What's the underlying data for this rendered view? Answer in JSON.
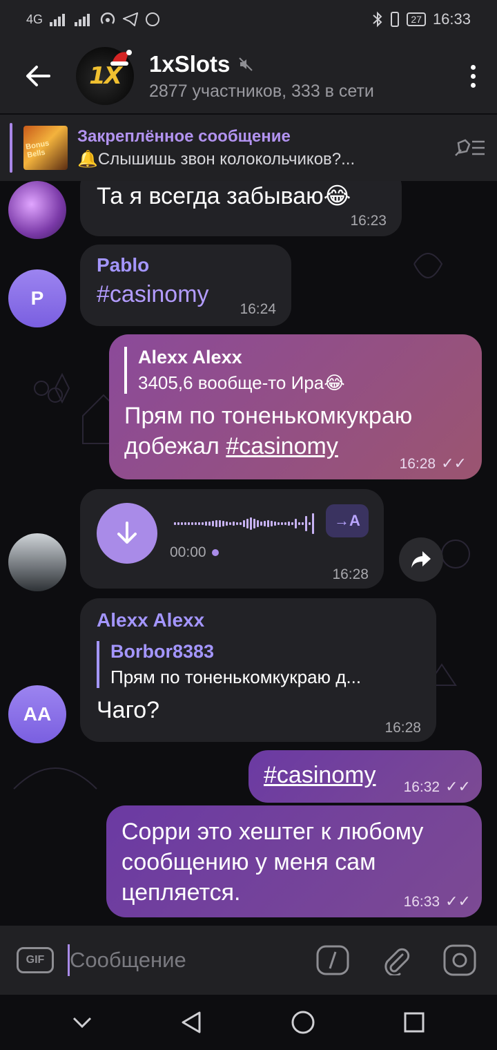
{
  "status_bar": {
    "signal_1": "4G",
    "signal_2": "",
    "battery": "27",
    "time": "16:33"
  },
  "header": {
    "title": "1xSlots",
    "subtitle": "2877 участников, 333 в сети",
    "avatar_logo_text": "1X"
  },
  "pinned": {
    "title": "Закреплённое сообщение",
    "message": "🔔Слышишь звон колокольчиков?...",
    "thumb_text": "Bonus Bells"
  },
  "messages": [
    {
      "type": "incoming",
      "text": "Та я всегда забываю😂",
      "time": "16:23"
    },
    {
      "type": "incoming",
      "sender": "Pablo",
      "avatar_initial": "P",
      "text": "#casinomy",
      "time": "16:24"
    },
    {
      "type": "outgoing",
      "reply_name": "Alexx Alexx",
      "reply_text": "3405,6 вообще-то Ира😂",
      "text_line1": "Прям по тоненькомкукраю",
      "text_line2_prefix": "добежал ",
      "text_line2_link": "#casinomy",
      "time": "16:28"
    },
    {
      "type": "voice",
      "duration": "00:00",
      "transcribe_label": "→A",
      "time": "16:28"
    },
    {
      "type": "incoming",
      "sender": "Alexx Alexx",
      "avatar_initial": "AA",
      "reply_name": "Borbor8383",
      "reply_text": "Прям по тоненькомкукраю д...",
      "text": "Чаго?",
      "time": "16:28"
    },
    {
      "type": "outgoing",
      "text": "#casinomy",
      "time": "16:32"
    },
    {
      "type": "outgoing",
      "text_line1": "Сорри это хештег к любому",
      "text_line2": "сообщению у меня сам",
      "text_line3": "цепляется.",
      "time": "16:33"
    }
  ],
  "input": {
    "placeholder": "Сообщение",
    "gif_label": "GIF"
  },
  "colors": {
    "accent": "#a98be8",
    "incoming_bubble": "#222226",
    "outgoing_bubble": "#8b4a9a"
  }
}
